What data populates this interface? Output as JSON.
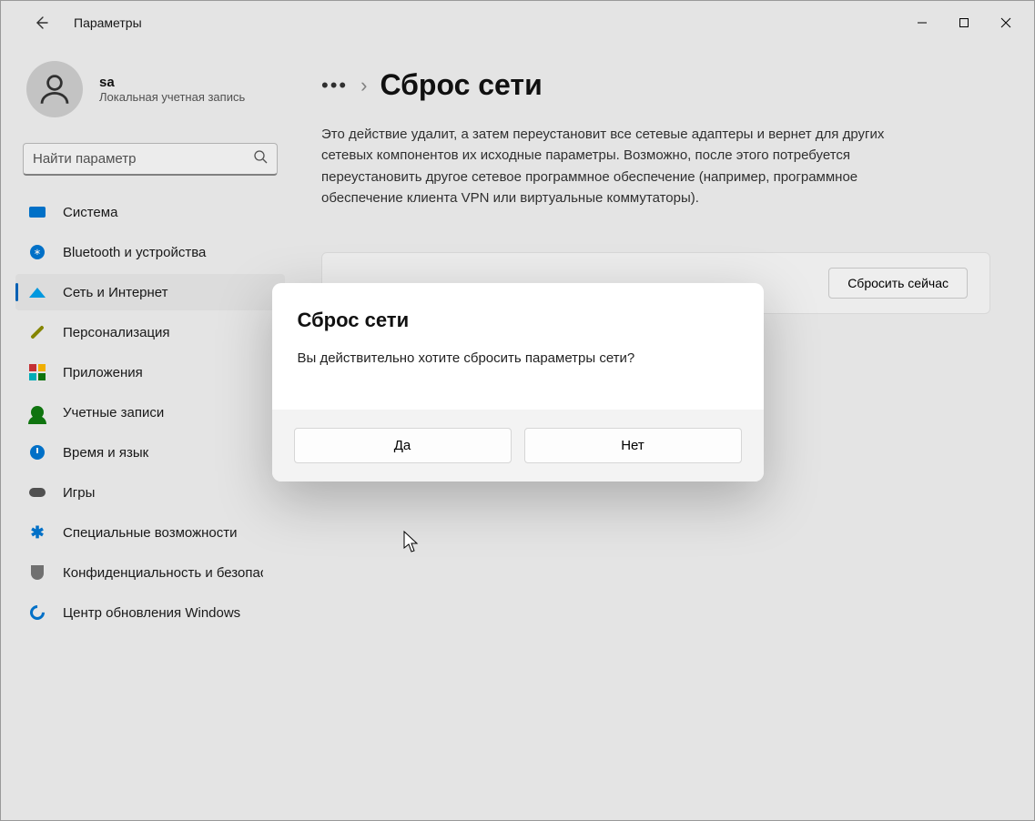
{
  "titlebar": {
    "title": "Параметры"
  },
  "account": {
    "name": "sa",
    "type": "Локальная учетная запись"
  },
  "search": {
    "placeholder": "Найти параметр"
  },
  "sidebar": {
    "items": [
      {
        "label": "Система"
      },
      {
        "label": "Bluetooth и устройства"
      },
      {
        "label": "Сеть и Интернет"
      },
      {
        "label": "Персонализация"
      },
      {
        "label": "Приложения"
      },
      {
        "label": "Учетные записи"
      },
      {
        "label": "Время и язык"
      },
      {
        "label": "Игры"
      },
      {
        "label": "Специальные возможности"
      },
      {
        "label": "Конфиденциальность и безопасность"
      },
      {
        "label": "Центр обновления Windows"
      }
    ],
    "active_index": 2
  },
  "content": {
    "breadcrumb_more": "•••",
    "breadcrumb_sep": "›",
    "page_title": "Сброс сети",
    "description": "Это действие удалит, а затем переустановит все сетевые адаптеры и вернет для других сетевых компонентов их исходные параметры. Возможно, после этого потребуется переустановить другое сетевое программное обеспечение (например, программное обеспечение клиента VPN или виртуальные коммутаторы).",
    "reset_button": "Сбросить сейчас"
  },
  "dialog": {
    "title": "Сброс сети",
    "message": "Вы действительно хотите сбросить параметры сети?",
    "yes": "Да",
    "no": "Нет"
  }
}
